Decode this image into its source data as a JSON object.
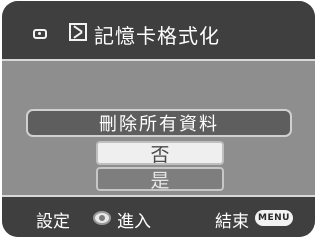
{
  "header": {
    "title": "記憶卡格式化",
    "mode_icon": "photo-mode-icon",
    "card_icon": "memory-card-icon"
  },
  "dialog": {
    "option_label": "刪除所有資料",
    "no_label": "否",
    "yes_label": "是"
  },
  "footer": {
    "set_label": "設定",
    "enter_label": "進入",
    "end_label": "結束",
    "menu_button_text": "MENU",
    "joystick_icon": "joystick-icon"
  },
  "colors": {
    "bar_bg": "#3f3f3f",
    "screen_bg": "#8e8e8e",
    "selected_button_bg": "#efefef"
  }
}
